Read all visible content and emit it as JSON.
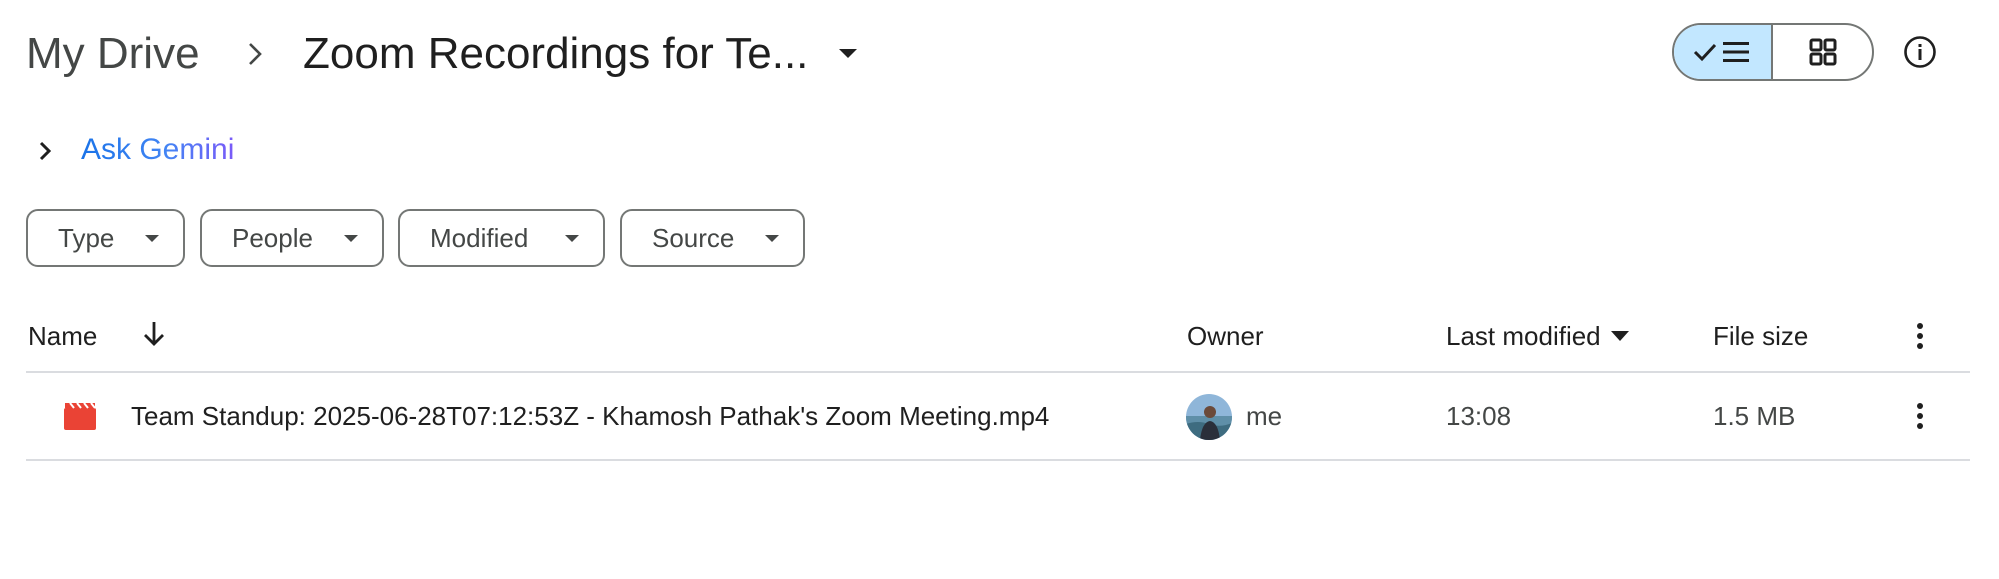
{
  "breadcrumb": {
    "root": "My Drive",
    "current": "Zoom Recordings for Te..."
  },
  "view_toggle": {
    "list_icon": "list-icon",
    "grid_icon": "grid-icon",
    "active": "list"
  },
  "info_icon": "info-icon",
  "gemini": {
    "label": "Ask Gemini"
  },
  "filters": [
    {
      "label": "Type"
    },
    {
      "label": "People"
    },
    {
      "label": "Modified"
    },
    {
      "label": "Source"
    }
  ],
  "table": {
    "columns": {
      "name": "Name",
      "owner": "Owner",
      "last_modified": "Last modified",
      "file_size": "File size"
    },
    "rows": [
      {
        "name": "Team Standup: 2025-06-28T07:12:53Z - Khamosh Pathak's Zoom Meeting.mp4",
        "owner": "me",
        "last_modified": "13:08",
        "file_size": "1.5 MB",
        "icon": "video-file-icon"
      }
    ]
  },
  "colors": {
    "accent_selected": "#c2e7ff",
    "file_icon_red": "#ea4335",
    "gemini_blue": "#1a73e8"
  }
}
